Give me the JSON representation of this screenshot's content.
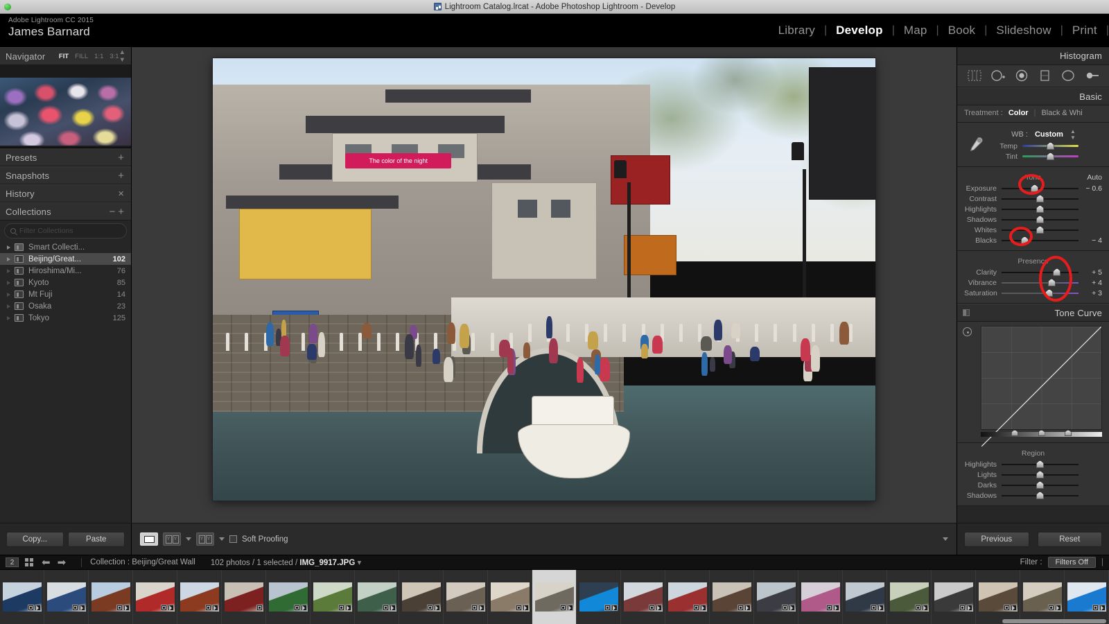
{
  "window": {
    "title": "Lightroom Catalog.lrcat - Adobe Photoshop Lightroom - Develop",
    "catalog_icon": "catalog-icon"
  },
  "identity": {
    "product": "Adobe Lightroom CC 2015",
    "user": "James Barnard"
  },
  "modules": {
    "items": [
      {
        "label": "Library",
        "active": false
      },
      {
        "label": "Develop",
        "active": true
      },
      {
        "label": "Map",
        "active": false
      },
      {
        "label": "Book",
        "active": false
      },
      {
        "label": "Slideshow",
        "active": false
      },
      {
        "label": "Print",
        "active": false
      }
    ],
    "separator": "|"
  },
  "navigator": {
    "title": "Navigator",
    "zoom_levels": [
      {
        "label": "FIT",
        "active": true
      },
      {
        "label": "FILL",
        "active": false
      },
      {
        "label": "1:1",
        "active": false
      },
      {
        "label": "3:1",
        "active": false
      }
    ],
    "stepper_icon": "updown-arrows-icon"
  },
  "left_panels": [
    {
      "title": "Presets",
      "action": "+",
      "action_icon": "plus-icon"
    },
    {
      "title": "Snapshots",
      "action": "+",
      "action_icon": "plus-icon"
    },
    {
      "title": "History",
      "action": "×",
      "action_icon": "close-icon"
    }
  ],
  "collections": {
    "title": "Collections",
    "minus_icon": "minus-icon",
    "plus_icon": "plus-icon",
    "filter_placeholder": "Filter Collections",
    "search_icon": "search-icon",
    "items": [
      {
        "name": "Smart Collecti...",
        "count": "",
        "selected": false,
        "smart": true
      },
      {
        "name": "Beijing/Great...",
        "count": "102",
        "selected": true,
        "smart": false
      },
      {
        "name": "Hiroshima/Mi...",
        "count": "76",
        "selected": false,
        "smart": false
      },
      {
        "name": "Kyoto",
        "count": "85",
        "selected": false,
        "smart": false
      },
      {
        "name": "Mt Fuji",
        "count": "14",
        "selected": false,
        "smart": false
      },
      {
        "name": "Osaka",
        "count": "23",
        "selected": false,
        "smart": false
      },
      {
        "name": "Tokyo",
        "count": "125",
        "selected": false,
        "smart": false
      }
    ]
  },
  "left_buttons": {
    "copy": "Copy...",
    "paste": "Paste"
  },
  "center_toolbar": {
    "loupe_icon": "loupe-view-icon",
    "compare_icon": "before-after-compare-icon",
    "compare_label_left": "Y",
    "compare_label_right": "Y",
    "soft_proofing_label": "Soft Proofing",
    "soft_proofing_checked": false,
    "collapse_icon": "chevron-down-icon"
  },
  "photo": {
    "caption_sign": "The color of the night",
    "alt": "Beijing canal with stone arch bridge, boat and crowds"
  },
  "right_panel": {
    "histogram_title": "Histogram",
    "tools": [
      {
        "name": "crop-overlay-icon"
      },
      {
        "name": "spot-removal-icon"
      },
      {
        "name": "red-eye-correction-icon"
      },
      {
        "name": "graduated-filter-icon"
      },
      {
        "name": "radial-filter-icon"
      },
      {
        "name": "adjustment-brush-icon"
      }
    ],
    "basic": {
      "title": "Basic",
      "treatment_label": "Treatment :",
      "treatment_options": [
        {
          "label": "Color",
          "active": true
        },
        {
          "label": "Black & Whi",
          "active": false
        }
      ],
      "eyedropper_icon": "white-balance-eyedropper-icon",
      "wb_label": "WB :",
      "wb_value": "Custom",
      "wb_dropdown_icon": "chevron-updown-icon",
      "wb_sliders": [
        {
          "label": "Temp",
          "value": "",
          "pos": 50,
          "kind": "temp"
        },
        {
          "label": "Tint",
          "value": "",
          "pos": 50,
          "kind": "tint"
        }
      ],
      "tone_title": "Tone",
      "auto_label": "Auto",
      "tone_sliders": [
        {
          "label": "Exposure",
          "value": "− 0.6",
          "pos": 43,
          "kind": "plain",
          "circled": true
        },
        {
          "label": "Contrast",
          "value": "",
          "pos": 50,
          "kind": "plain",
          "circled": false
        },
        {
          "label": "Highlights",
          "value": "",
          "pos": 50,
          "kind": "plain",
          "circled": false
        },
        {
          "label": "Shadows",
          "value": "",
          "pos": 50,
          "kind": "plain",
          "circled": false
        },
        {
          "label": "Whites",
          "value": "",
          "pos": 50,
          "kind": "plain",
          "circled": false
        },
        {
          "label": "Blacks",
          "value": "− 4",
          "pos": 30,
          "kind": "plain",
          "circled": true
        }
      ],
      "presence_title": "Presence",
      "presence_sliders": [
        {
          "label": "Clarity",
          "value": "+ 5",
          "pos": 72,
          "kind": "plain"
        },
        {
          "label": "Vibrance",
          "value": "+ 4",
          "pos": 65,
          "kind": "vib"
        },
        {
          "label": "Saturation",
          "value": "+ 3",
          "pos": 62,
          "kind": "sat"
        }
      ]
    },
    "tone_curve": {
      "title": "Tone Curve",
      "panel_switch_icon": "panel-switch-icon",
      "target_adjust_icon": "target-adjustment-icon",
      "region_title": "Region",
      "region_sliders": [
        {
          "label": "Highlights",
          "value": "",
          "pos": 50
        },
        {
          "label": "Lights",
          "value": "",
          "pos": 50
        },
        {
          "label": "Darks",
          "value": "",
          "pos": 50
        },
        {
          "label": "Shadows",
          "value": "",
          "pos": 50
        }
      ],
      "ramp_knobs": [
        28,
        50,
        72
      ]
    },
    "buttons": {
      "previous": "Previous",
      "reset": "Reset"
    }
  },
  "filmstrip_bar": {
    "count_badge": "2",
    "grid_icon": "grid-view-icon",
    "back_icon": "back-arrow-icon",
    "forward_icon": "forward-arrow-icon",
    "source": "Collection : Beijing/Great Wall",
    "selection_prefix": "102 photos / 1 selected / ",
    "selection_file": "IMG_9917.JPG",
    "selection_dropdown_icon": "chevron-down-icon",
    "filter_label": "Filter :",
    "filters_state": "Filters Off"
  },
  "filmstrip": {
    "selected_index": 12,
    "thumbs": [
      {
        "c1": "#1d3a63",
        "c2": "#c6d2de",
        "badges": 2
      },
      {
        "c1": "#2a4b7c",
        "c2": "#d8dde2",
        "badges": 2
      },
      {
        "c1": "#7b3a22",
        "c2": "#b9cde0",
        "badges": 2
      },
      {
        "c1": "#b02a2a",
        "c2": "#d9d4cc",
        "badges": 2
      },
      {
        "c1": "#8d3b20",
        "c2": "#cdd8e4",
        "badges": 2
      },
      {
        "c1": "#7c2020",
        "c2": "#c8c0b4",
        "badges": 1
      },
      {
        "c1": "#2f6b32",
        "c2": "#b8c4cf",
        "badges": 2
      },
      {
        "c1": "#5a7b3a",
        "c2": "#cfd9c8",
        "badges": 2
      },
      {
        "c1": "#3e5f4a",
        "c2": "#c3d0c6",
        "badges": 2
      },
      {
        "c1": "#4a4036",
        "c2": "#cfc6b8",
        "badges": 2
      },
      {
        "c1": "#6b6054",
        "c2": "#d3cbc0",
        "badges": 2
      },
      {
        "c1": "#8a7a68",
        "c2": "#ded6c8",
        "badges": 2
      },
      {
        "c1": "#6e6a60",
        "c2": "#d8d3c8",
        "badges": 2
      },
      {
        "c1": "#1189d8",
        "c2": "#2f3f52",
        "badges": 2
      },
      {
        "c1": "#7a3a3a",
        "c2": "#d2d8de",
        "badges": 2
      },
      {
        "c1": "#9a3030",
        "c2": "#cdd5dd",
        "badges": 2
      },
      {
        "c1": "#5a4436",
        "c2": "#c9c2b6",
        "badges": 2
      },
      {
        "c1": "#3c3c44",
        "c2": "#bcc4cc",
        "badges": 2
      },
      {
        "c1": "#b05a8a",
        "c2": "#d6cfd8",
        "badges": 2
      },
      {
        "c1": "#2f3a46",
        "c2": "#c0c8d0",
        "badges": 2
      },
      {
        "c1": "#4a5a3a",
        "c2": "#c8d0bc",
        "badges": 2
      },
      {
        "c1": "#3a3a3a",
        "c2": "#cbcbcb",
        "badges": 2
      },
      {
        "c1": "#5a4a3a",
        "c2": "#cfc4b4",
        "badges": 2
      },
      {
        "c1": "#6a6050",
        "c2": "#d4ccbe",
        "badges": 2
      },
      {
        "c1": "#1a7ad0",
        "c2": "#dfe8f0",
        "badges": 2
      },
      {
        "c1": "#7a6a58",
        "c2": "#d8d0c2",
        "badges": 2
      }
    ]
  }
}
